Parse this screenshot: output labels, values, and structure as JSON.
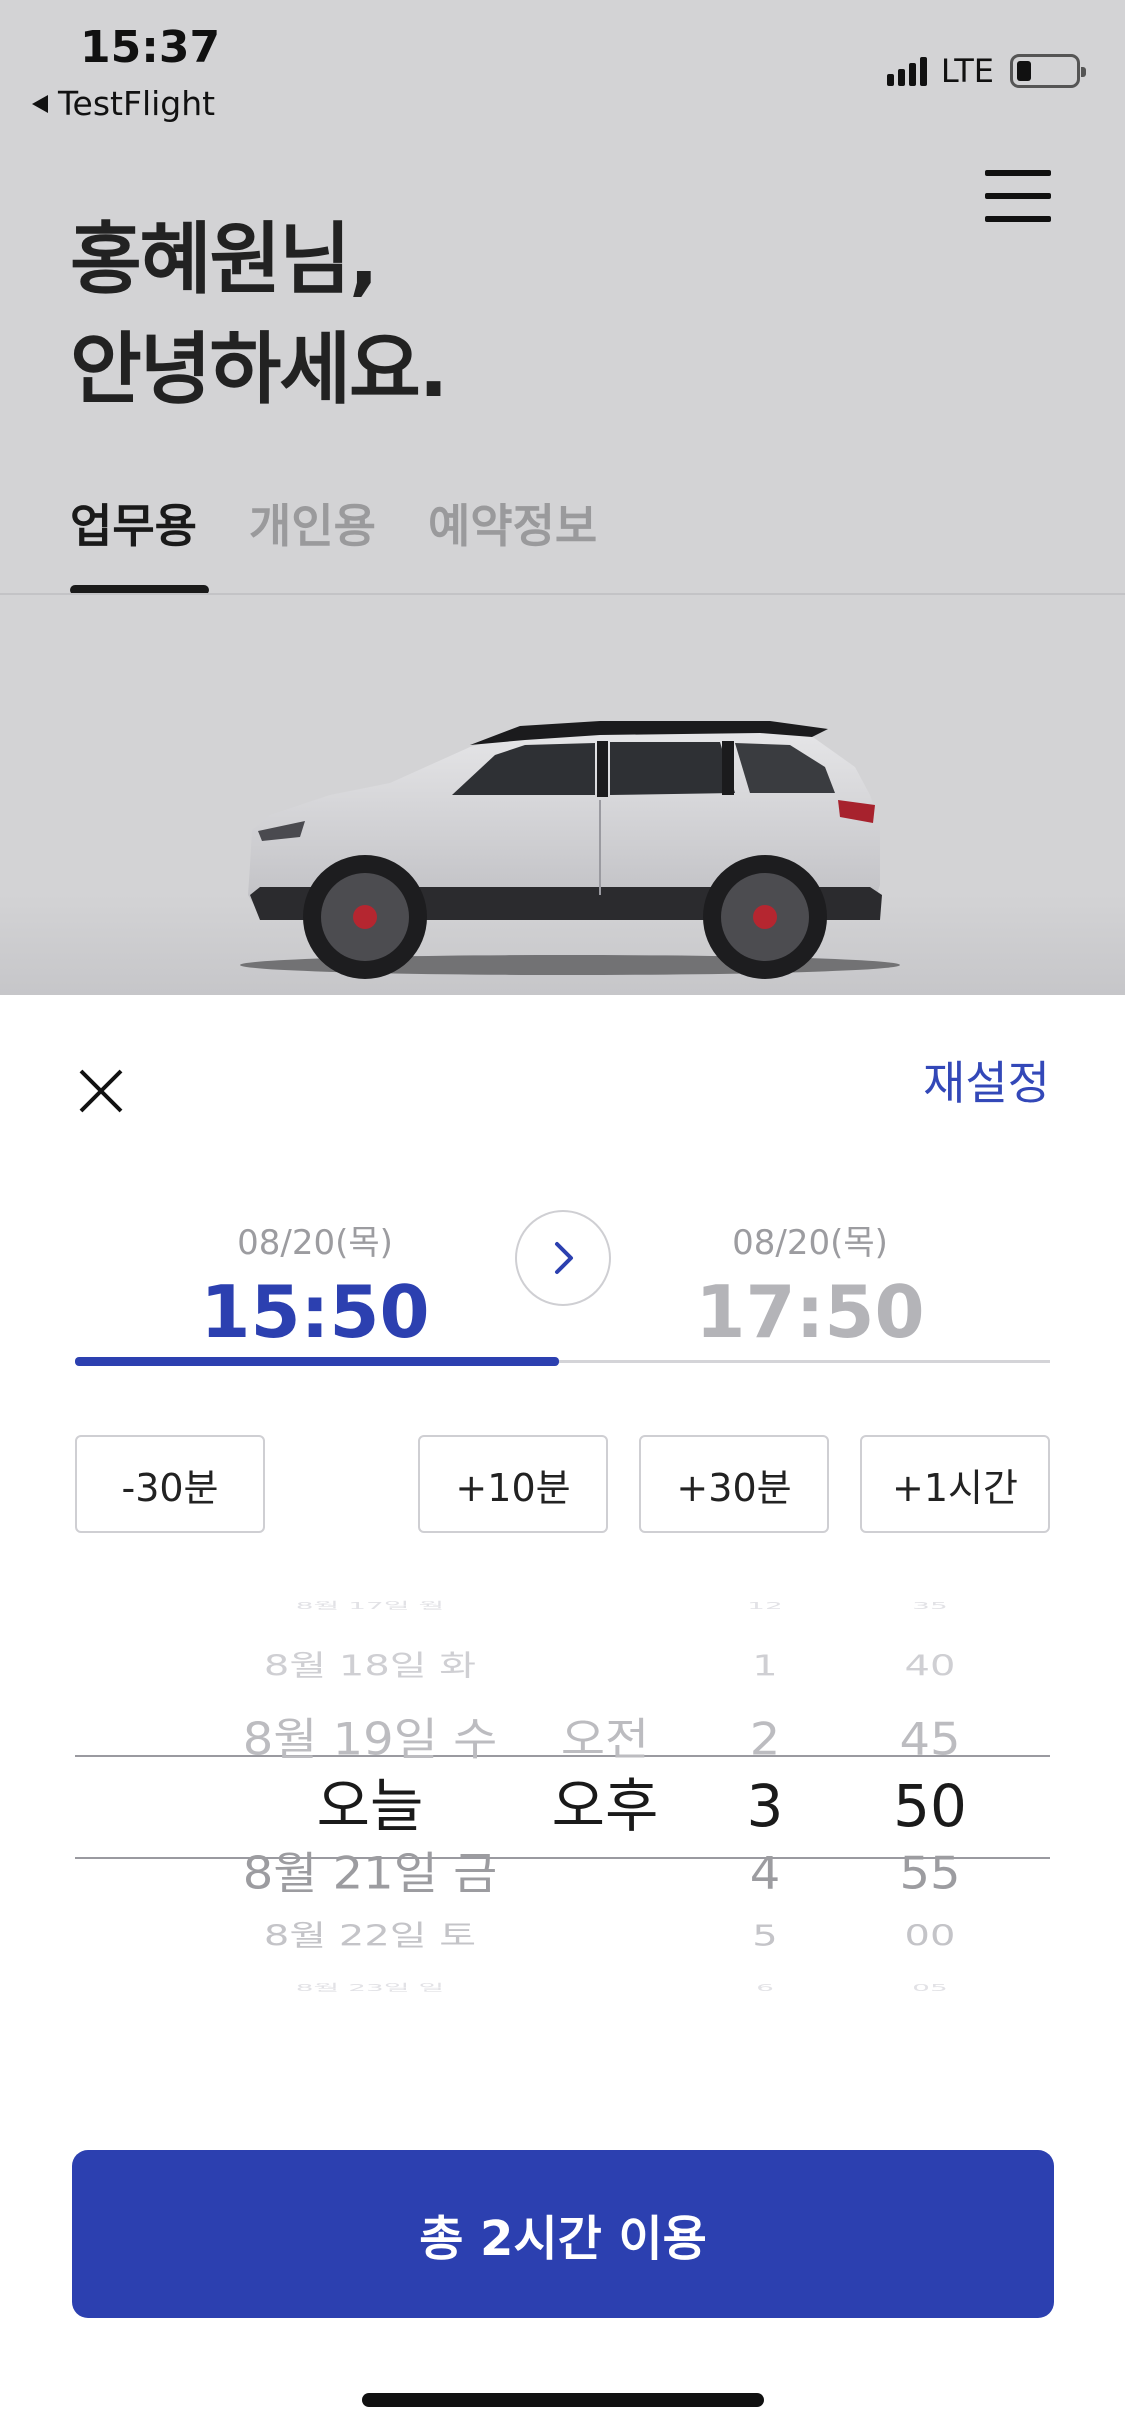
{
  "status_bar": {
    "time": "15:37",
    "back_label": "TestFlight",
    "network": "LTE"
  },
  "header": {
    "greeting_line1": "홍혜원님,",
    "greeting_line2": "안녕하세요.",
    "tabs": [
      {
        "label": "업무용",
        "active": true
      },
      {
        "label": "개인용",
        "active": false
      },
      {
        "label": "예약정보",
        "active": false
      }
    ],
    "menu_icon": "hamburger-menu-icon"
  },
  "sheet": {
    "reset_label": "재설정",
    "close_icon": "close-icon",
    "start": {
      "date": "08/20(목)",
      "time": "15:50"
    },
    "end": {
      "date": "08/20(목)",
      "time": "17:50"
    },
    "arrow_icon": "chevron-right-icon",
    "progress": 0.5,
    "quick_buttons": [
      "-30분",
      "+10분",
      "+30분",
      "+1시간"
    ],
    "picker": {
      "rows": [
        {
          "date": "8월 17일 월",
          "ampm": "",
          "hour": "12",
          "minute": "35"
        },
        {
          "date": "8월 18일 화",
          "ampm": "",
          "hour": "1",
          "minute": "40"
        },
        {
          "date": "8월 19일 수",
          "ampm": "오전",
          "hour": "2",
          "minute": "45"
        },
        {
          "date": "오늘",
          "ampm": "오후",
          "hour": "3",
          "minute": "50"
        },
        {
          "date": "8월 21일 금",
          "ampm": "",
          "hour": "4",
          "minute": "55"
        },
        {
          "date": "8월 22일 토",
          "ampm": "",
          "hour": "5",
          "minute": "00"
        },
        {
          "date": "8월 23일 일",
          "ampm": "",
          "hour": "6",
          "minute": "05"
        }
      ]
    },
    "confirm_label": "총 2시간 이용"
  },
  "colors": {
    "accent": "#2c40b0",
    "background": "#d3d3d5",
    "inactive_time": "#b4b4b8"
  }
}
